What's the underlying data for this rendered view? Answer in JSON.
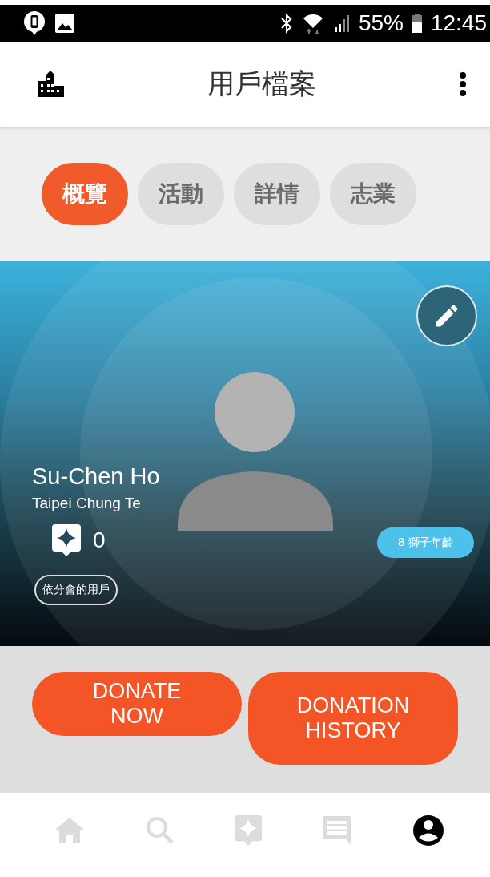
{
  "status_bar": {
    "battery": "55%",
    "time": "12:45"
  },
  "app_bar": {
    "title": "用戶檔案"
  },
  "tabs": [
    {
      "label": "概覽",
      "selected": true
    },
    {
      "label": "活動",
      "selected": false
    },
    {
      "label": "詳情",
      "selected": false
    },
    {
      "label": "志業",
      "selected": false
    }
  ],
  "profile": {
    "name": "Su-Chen Ho",
    "location": "Taipei Chung Te",
    "points": "0",
    "age_badge": "8 獅子年齡",
    "member_tag": "依分會的用戶"
  },
  "actions": [
    {
      "label": "DONATE NOW"
    },
    {
      "label": "DONATION HISTORY"
    }
  ],
  "bottom_nav": [
    {
      "kind": "home",
      "selected": false
    },
    {
      "kind": "search",
      "selected": false
    },
    {
      "kind": "sparkle",
      "selected": false
    },
    {
      "kind": "messages",
      "selected": false
    },
    {
      "kind": "profile",
      "selected": true
    }
  ]
}
